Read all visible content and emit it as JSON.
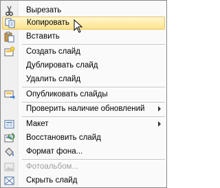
{
  "context_menu": {
    "items": [
      {
        "label": "Вырезать",
        "icon": "scissors-icon"
      },
      {
        "label": "Копировать",
        "icon": "copy-icon"
      },
      {
        "label": "Вставить",
        "icon": "paste-icon"
      },
      {
        "label": "Создать слайд",
        "icon": "new-slide-icon"
      },
      {
        "label": "Дублировать слайд",
        "icon": ""
      },
      {
        "label": "Удалить слайд",
        "icon": ""
      },
      {
        "label": "Опубликовать слайды",
        "icon": "publish-slides-icon"
      },
      {
        "label": "Проверить наличие обновлений",
        "icon": ""
      },
      {
        "label": "Макет",
        "icon": "layout-icon"
      },
      {
        "label": "Восстановить слайд",
        "icon": "reset-slide-icon"
      },
      {
        "label": "Формат фона...",
        "icon": "format-background-icon"
      },
      {
        "label": "Фотоальбом...",
        "icon": "photo-album-icon"
      },
      {
        "label": "Скрыть слайд",
        "icon": "hide-slide-icon"
      }
    ],
    "highlighted_item": "Копировать",
    "disabled_item": "Фотоальбом...",
    "highlight_color": "#ffe38a",
    "border_color": "#868686"
  }
}
